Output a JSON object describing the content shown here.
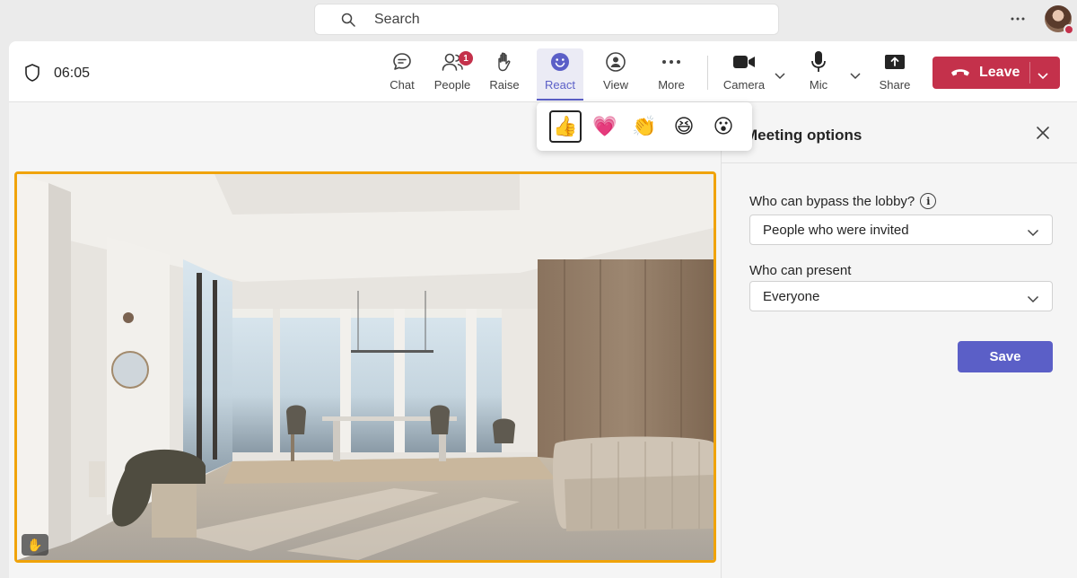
{
  "search": {
    "placeholder": "Search"
  },
  "meeting": {
    "timer": "06:05"
  },
  "toolbar": {
    "chat": "Chat",
    "people": "People",
    "people_badge": "1",
    "raise": "Raise",
    "react": "React",
    "view": "View",
    "more": "More",
    "camera": "Camera",
    "mic": "Mic",
    "share": "Share",
    "leave": "Leave"
  },
  "reactions": [
    "👍",
    "💗",
    "👏",
    "😆",
    "😮"
  ],
  "panel": {
    "title": "Meeting options",
    "lobby_label": "Who can bypass the lobby?",
    "lobby_value": "People who were invited",
    "present_label": "Who can present",
    "present_value": "Everyone",
    "save": "Save"
  },
  "video": {
    "raise_emoji": "✋"
  },
  "colors": {
    "accent": "#5b5fc7",
    "leave": "#c4314b",
    "frame": "#f0a30a"
  }
}
